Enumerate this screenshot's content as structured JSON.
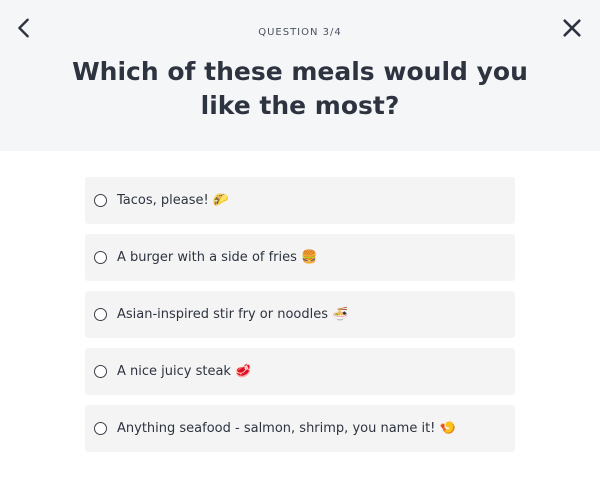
{
  "header": {
    "progress_label": "QUESTION 3/4",
    "question": "Which of these meals would you like the most?",
    "back_icon": "chevron-left-icon",
    "close_icon": "close-icon"
  },
  "options": [
    {
      "label": "Tacos, please! 🌮",
      "selected": false
    },
    {
      "label": "A burger with a side of fries 🍔",
      "selected": false
    },
    {
      "label": "Asian-inspired stir fry or noodles 🍜",
      "selected": false
    },
    {
      "label": "A nice juicy steak 🥩",
      "selected": false
    },
    {
      "label": "Anything seafood - salmon, shrimp, you name it! 🍤",
      "selected": false
    }
  ],
  "colors": {
    "header_bg": "#f5f6f8",
    "option_bg": "#f4f4f4",
    "text": "#2d3440"
  }
}
